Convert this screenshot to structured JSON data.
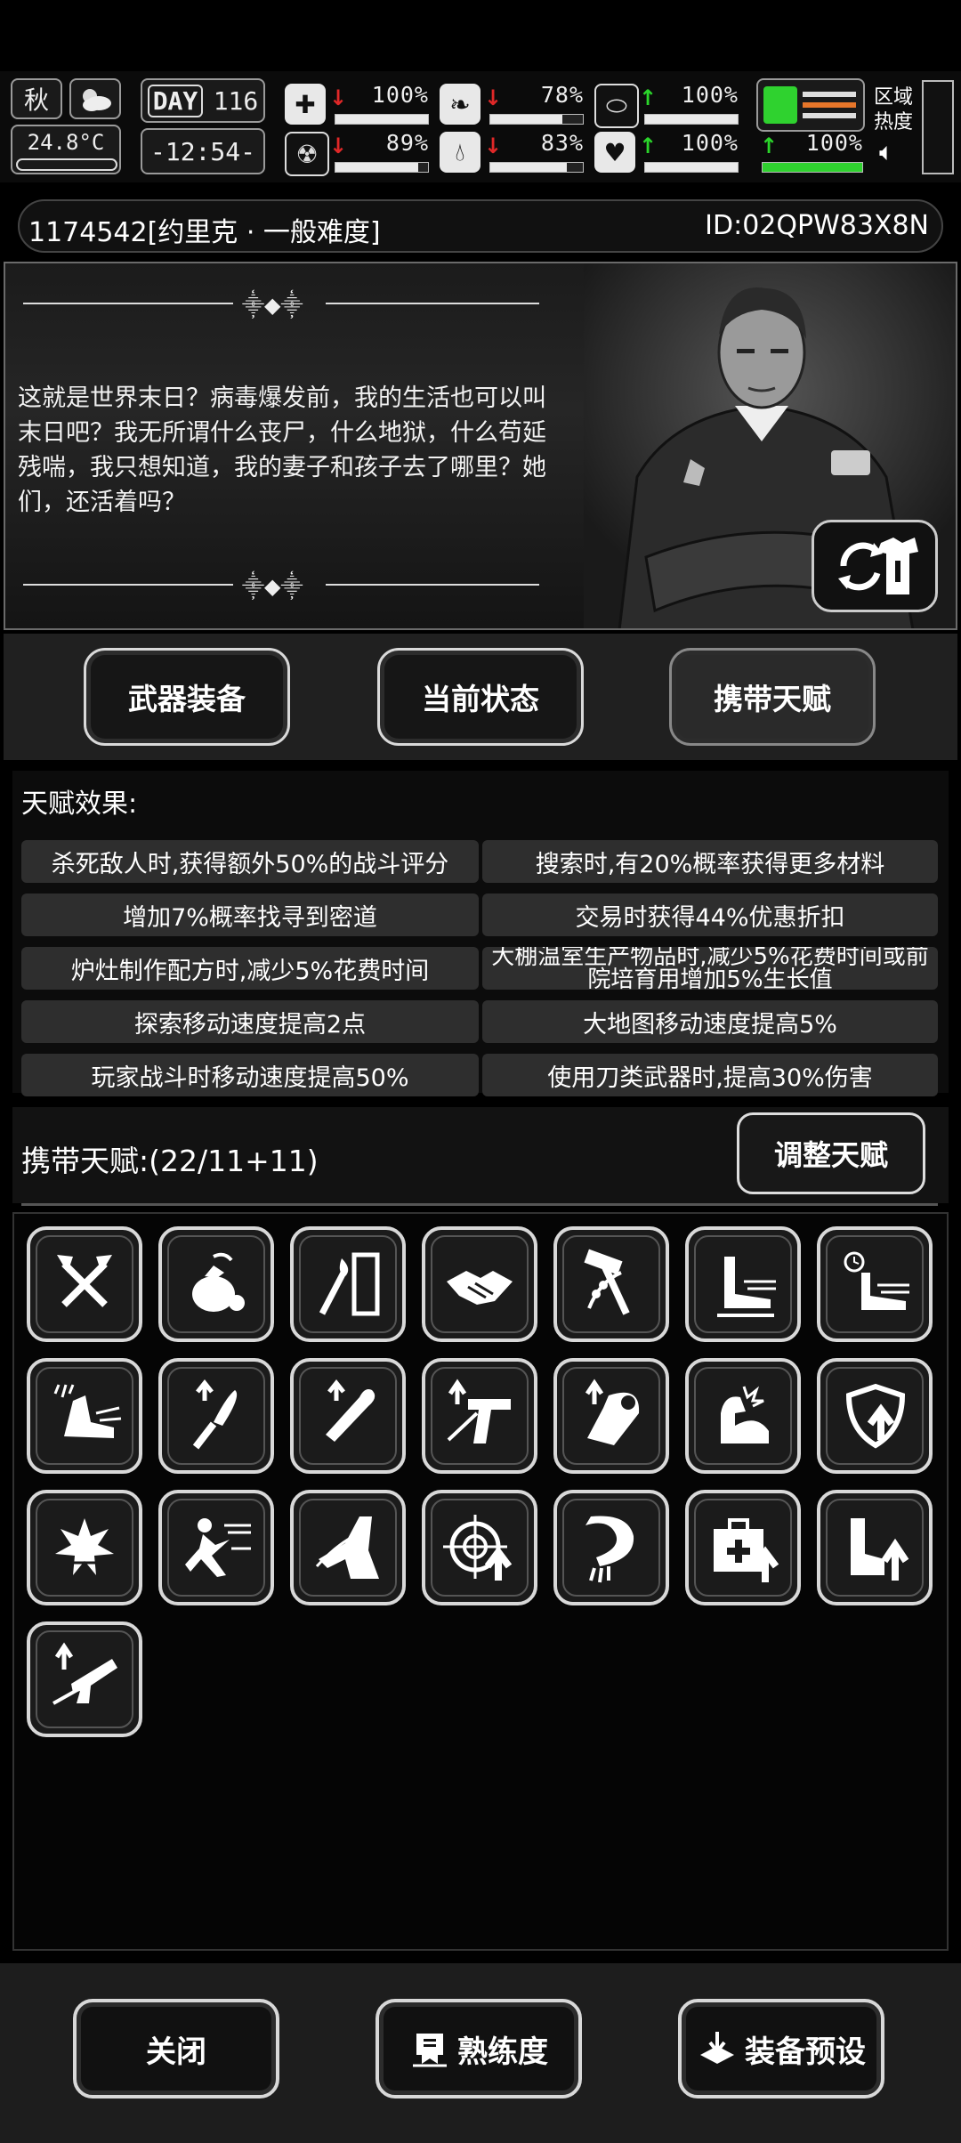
{
  "hud": {
    "season": "秋",
    "temperature": "24.8°C",
    "day_label": "DAY",
    "day_number": "116",
    "clock": "-12:54-",
    "stats": [
      {
        "icon": "medkit-icon",
        "arrow": "down",
        "value": "100%",
        "level": 1.0
      },
      {
        "icon": "stomach-icon",
        "arrow": "down",
        "value": "78%",
        "level": 0.78
      },
      {
        "icon": "pill-icon",
        "arrow": "up",
        "value": "100%",
        "level": 1.0
      },
      {
        "icon": "brain-icon",
        "arrow": "down",
        "value": "89%",
        "level": 0.89
      },
      {
        "icon": "water-drop-icon",
        "arrow": "down",
        "value": "83%",
        "level": 0.83
      },
      {
        "icon": "heart-icon",
        "arrow": "up",
        "value": "100%",
        "level": 1.0
      }
    ],
    "stamina": {
      "arrow": "up",
      "value": "100%",
      "level": 1.0
    },
    "zone_label": "区域热度"
  },
  "header": {
    "save_name": "1174542[约里克 · 一般难度]",
    "id": "ID:02QPW83X8N"
  },
  "story": {
    "text": "这就是世界末日？病毒爆发前，我的生活也可以叫末日吧？我无所谓什么丧尸，什么地狱，什么苟延残喘，我只想知道，我的妻子和孩子去了哪里？她们，还活着吗？"
  },
  "tabs": [
    {
      "label": "武器装备",
      "active": false
    },
    {
      "label": "当前状态",
      "active": false
    },
    {
      "label": "携带天赋",
      "active": true
    }
  ],
  "effects": {
    "title": "天赋效果:",
    "rows": [
      [
        "杀死敌人时,获得额外50%的战斗评分",
        "搜索时,有20%概率获得更多材料"
      ],
      [
        "增加7%概率找寻到密道",
        "交易时获得44%优惠折扣"
      ],
      [
        "炉灶制作配方时,减少5%花费时间",
        "大棚温室生产物品时,减少5%花费时间或前院培育用增加5%生长值"
      ],
      [
        "探索移动速度提高2点",
        "大地图移动速度提高5%"
      ],
      [
        "玩家战斗时移动速度提高50%",
        "使用刀类武器时,提高30%伤害"
      ]
    ]
  },
  "carry": {
    "title": "携带天赋:(22/11+11)",
    "adjust_label": "调整天赋",
    "talents": [
      "crossed-axes-icon",
      "money-bag-icon",
      "torch-door-icon",
      "handshake-icon",
      "hammer-wheat-icon",
      "running-boot-icon",
      "timed-boot-icon",
      "fast-kick-icon",
      "machete-up-icon",
      "bat-up-icon",
      "pistol-up-icon",
      "armor-up-icon",
      "flexed-arm-icon",
      "shield-up-icon",
      "explosion-icon",
      "sprint-icon",
      "leg-step-icon",
      "crosshair-up-icon",
      "rope-arm-icon",
      "medkit-up-icon",
      "boot-up-icon",
      "rifle-up-icon"
    ]
  },
  "bottom": {
    "close_label": "关闭",
    "mastery_label": "熟练度",
    "preset_label": "装备预设"
  }
}
